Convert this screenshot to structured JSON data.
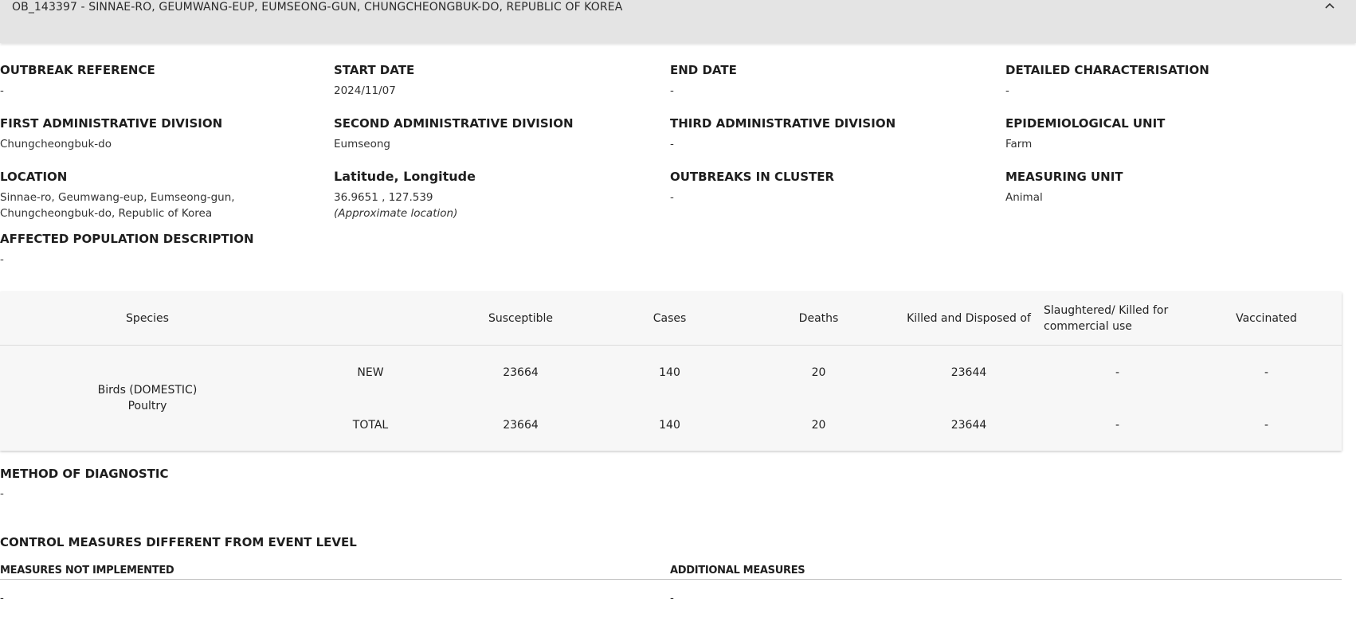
{
  "header": {
    "title": "OB_143397 - SINNAE-RO, GEUMWANG-EUP, EUMSEONG-GUN, CHUNGCHEONGBUK-DO, REPUBLIC OF KOREA",
    "collapse_icon": "chevron-up-icon"
  },
  "fields": {
    "outbreak_reference": {
      "label": "OUTBREAK REFERENCE",
      "value": "-"
    },
    "start_date": {
      "label": "START DATE",
      "value": "2024/11/07"
    },
    "end_date": {
      "label": "END DATE",
      "value": "-"
    },
    "detailed_characterisation": {
      "label": "DETAILED CHARACTERISATION",
      "value": "-"
    },
    "first_admin_division": {
      "label": "FIRST ADMINISTRATIVE DIVISION",
      "value": "Chungcheongbuk-do"
    },
    "second_admin_division": {
      "label": "SECOND ADMINISTRATIVE DIVISION",
      "value": "Eumseong"
    },
    "third_admin_division": {
      "label": "THIRD ADMINISTRATIVE DIVISION",
      "value": "-"
    },
    "epidemiological_unit": {
      "label": "EPIDEMIOLOGICAL UNIT",
      "value": "Farm"
    },
    "location": {
      "label": "LOCATION",
      "line1": "Sinnae-ro, Geumwang-eup, Eumseong-gun,",
      "line2": "Chungcheongbuk-do, Republic of Korea"
    },
    "lat_long": {
      "label": "Latitude, Longitude",
      "value": "36.9651 , 127.539",
      "note": "(Approximate location)"
    },
    "outbreaks_in_cluster": {
      "label": "OUTBREAKS IN CLUSTER",
      "value": "-"
    },
    "measuring_unit": {
      "label": "MEASURING UNIT",
      "value": "Animal"
    },
    "affected_population": {
      "label": "AFFECTED POPULATION DESCRIPTION",
      "value": "-"
    }
  },
  "table": {
    "headers": {
      "species": "Species",
      "susceptible": "Susceptible",
      "cases": "Cases",
      "deaths": "Deaths",
      "killed": "Killed and Disposed of",
      "slaughtered_line1": "Slaughtered/ Killed for",
      "slaughtered_line2": "commercial use",
      "vaccinated": "Vaccinated"
    },
    "species_line1": "Birds (DOMESTIC)",
    "species_line2": "Poultry",
    "rows": [
      {
        "type": "NEW",
        "susceptible": "23664",
        "cases": "140",
        "deaths": "20",
        "killed": "23644",
        "slaughtered": "-",
        "vaccinated": "-"
      },
      {
        "type": "TOTAL",
        "susceptible": "23664",
        "cases": "140",
        "deaths": "20",
        "killed": "23644",
        "slaughtered": "-",
        "vaccinated": "-"
      }
    ]
  },
  "method_of_diagnostic": {
    "label": "METHOD OF DIAGNOSTIC",
    "value": "-"
  },
  "control_measures": {
    "title": "CONTROL MEASURES DIFFERENT FROM EVENT LEVEL",
    "not_implemented_label": "MEASURES NOT IMPLEMENTED",
    "not_implemented_value": "-",
    "additional_label": "ADDITIONAL MEASURES",
    "additional_value": "-"
  }
}
